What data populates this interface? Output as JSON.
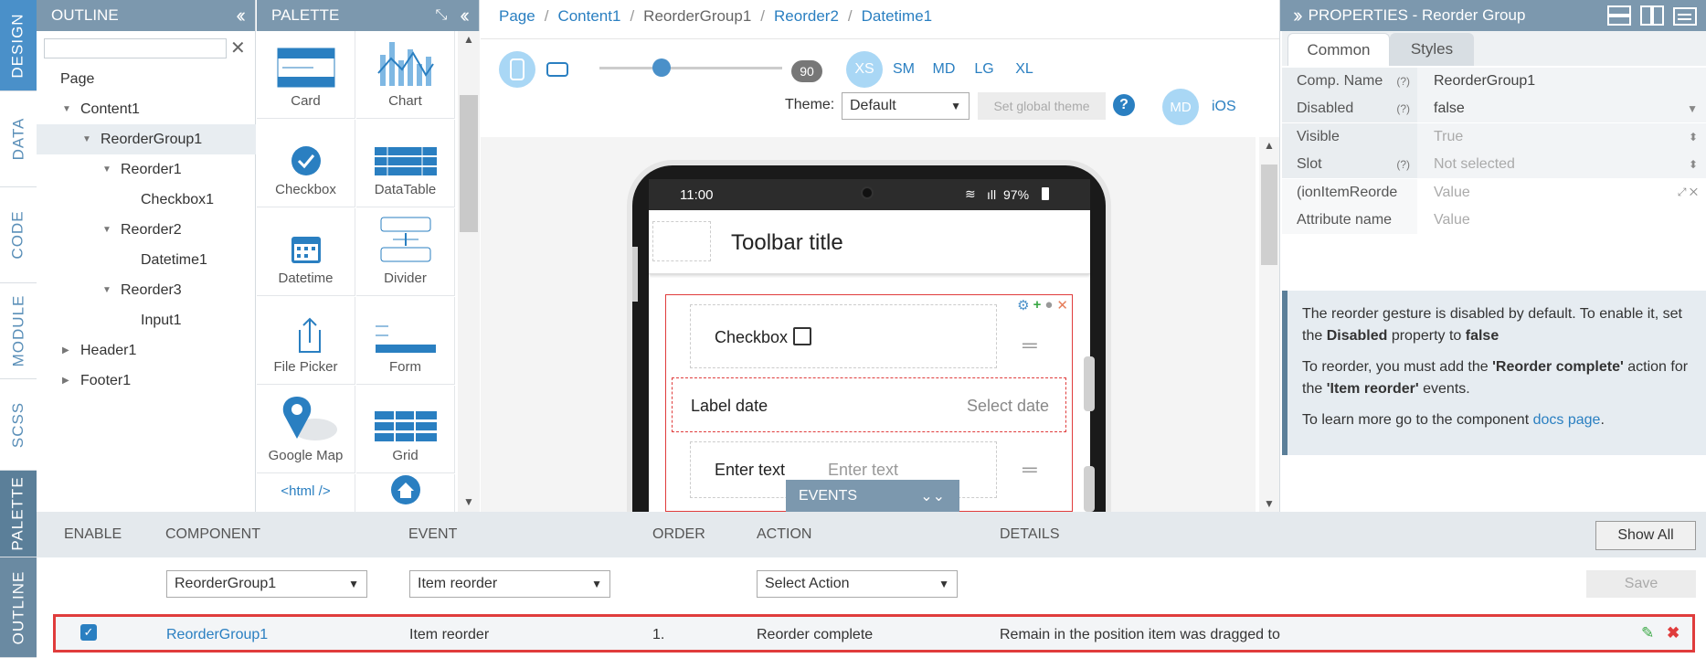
{
  "vtabs": [
    {
      "label": "DESIGN",
      "state": "active"
    },
    {
      "label": "DATA",
      "state": "normal"
    },
    {
      "label": "CODE",
      "state": "normal"
    },
    {
      "label": "MODULE",
      "state": "normal"
    },
    {
      "label": "SCSS",
      "state": "normal"
    },
    {
      "label": "PALETTE",
      "state": "dark"
    },
    {
      "label": "OUTLINE",
      "state": "normal"
    }
  ],
  "outline": {
    "title": "OUTLINE",
    "clear_icon": "✕",
    "tree": [
      {
        "label": "Page",
        "indent": 0,
        "arrow": ""
      },
      {
        "label": "Content1",
        "indent": 1,
        "arrow": "▼"
      },
      {
        "label": "ReorderGroup1",
        "indent": 2,
        "arrow": "▼",
        "selected": true
      },
      {
        "label": "Reorder1",
        "indent": 3,
        "arrow": "▼"
      },
      {
        "label": "Checkbox1",
        "indent": 4,
        "arrow": ""
      },
      {
        "label": "Reorder2",
        "indent": 3,
        "arrow": "▼"
      },
      {
        "label": "Datetime1",
        "indent": 4,
        "arrow": ""
      },
      {
        "label": "Reorder3",
        "indent": 3,
        "arrow": "▼"
      },
      {
        "label": "Input1",
        "indent": 4,
        "arrow": ""
      },
      {
        "label": "Header1",
        "indent": 1,
        "arrow": "▶"
      },
      {
        "label": "Footer1",
        "indent": 1,
        "arrow": "▶"
      }
    ]
  },
  "palette": {
    "title": "PALETTE",
    "items": [
      "Card",
      "Chart",
      "Checkbox",
      "DataTable",
      "Datetime",
      "Divider",
      "File Picker",
      "Form",
      "Google Map",
      "Grid",
      "<html />",
      ""
    ]
  },
  "breadcrumb": {
    "items": [
      "Page",
      "Content1",
      "ReorderGroup1",
      "Reorder2",
      "Datetime1"
    ]
  },
  "toolbar": {
    "slider_value": "90",
    "sizes": [
      "XS",
      "SM",
      "MD",
      "LG",
      "XL"
    ],
    "theme_label": "Theme:",
    "theme_value": "Default",
    "set_global_theme": "Set global theme",
    "help": "?",
    "md": "MD",
    "ios": "iOS"
  },
  "phone": {
    "time": "11:00",
    "battery": "97%",
    "toolbar_title": "Toolbar title",
    "checkbox_label": "Checkbox",
    "date_label": "Label date",
    "date_placeholder": "Select date",
    "input_label": "Enter text",
    "input_placeholder": "Enter text"
  },
  "events_bar": {
    "label": "EVENTS"
  },
  "properties": {
    "title": "PROPERTIES - Reorder Group",
    "tabs": [
      "Common",
      "Styles"
    ],
    "rows": [
      {
        "label": "Comp. Name",
        "help": "(?)",
        "value": "ReorderGroup1",
        "dim": false,
        "ctrl": ""
      },
      {
        "label": "Disabled",
        "help": "(?)",
        "value": "false",
        "dim": false,
        "ctrl": "▼"
      },
      {
        "label": "Visible",
        "help": "",
        "value": "True",
        "dim": true,
        "ctrl": "⬍"
      },
      {
        "label": "Slot",
        "help": "(?)",
        "value": "Not selected",
        "dim": true,
        "ctrl": "⬍"
      },
      {
        "label": "(ionItemReorde",
        "help": "",
        "value": "Value",
        "dim": true,
        "ctrl": "⤢ ✕"
      },
      {
        "label": "Attribute name",
        "help": "",
        "value": "Value",
        "dim": true,
        "ctrl": ""
      }
    ],
    "info": {
      "p1a": "The reorder gesture is disabled by default. To enable it, set the ",
      "p1b": "Disabled",
      "p1c": " property to ",
      "p1d": "false",
      "p2a": "To reorder, you must add the ",
      "p2b": "'Reorder complete'",
      "p2c": " action for the ",
      "p2d": "'Item reorder'",
      "p2e": " events.",
      "p3a": "To learn more go to the component ",
      "p3b": "docs page",
      "p3c": "."
    }
  },
  "events": {
    "columns": [
      "ENABLE",
      "COMPONENT",
      "EVENT",
      "ORDER",
      "ACTION",
      "DETAILS"
    ],
    "show_all": "Show All",
    "component_select": "ReorderGroup1",
    "event_select": "Item reorder",
    "action_select": "Select Action",
    "save": "Save",
    "row": {
      "enabled": true,
      "component": "ReorderGroup1",
      "event": "Item reorder",
      "order": "1.",
      "action": "Reorder complete",
      "details": "Remain in the position item was dragged to"
    }
  },
  "colors": {
    "accent": "#2a7fc1",
    "panel_header": "#7c98ae",
    "highlight_border": "#e03c3c"
  }
}
